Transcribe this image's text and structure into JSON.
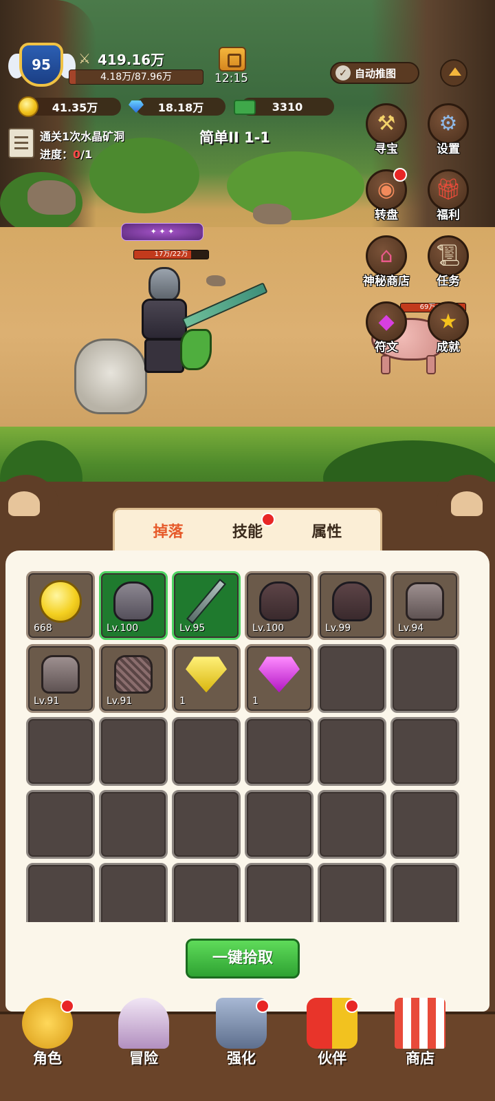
{
  "player": {
    "level": "95",
    "power": "419.16万",
    "exp_text": "4.18万/87.96万",
    "exp_fraction": 0.0475,
    "time": "12:15"
  },
  "auto_push": {
    "label": "自动推图",
    "checked": true
  },
  "resources": {
    "gold": "41.35万",
    "diamond": "18.18万",
    "cash": "3310"
  },
  "quest": {
    "title": "通关1次水晶矿洞",
    "progress_label": "进度：",
    "progress_current": "0",
    "progress_total": "/1"
  },
  "stage": "简单II 1-1",
  "side_menu": [
    {
      "label": "寻宝",
      "icon": "hammer-icon",
      "badge": false
    },
    {
      "label": "设置",
      "icon": "gear-icon",
      "badge": false
    },
    {
      "label": "转盘",
      "icon": "wheel-icon",
      "badge": true
    },
    {
      "label": "福利",
      "icon": "gift-icon",
      "badge": false
    },
    {
      "label": "神秘商店",
      "icon": "shop-icon",
      "badge": false
    },
    {
      "label": "任务",
      "icon": "scroll-icon",
      "badge": false
    },
    {
      "label": "符文",
      "icon": "rune-gem-icon",
      "badge": false
    },
    {
      "label": "成就",
      "icon": "star-icon",
      "badge": false
    }
  ],
  "battle": {
    "hero_hp_text": "17万/22万",
    "hero_hp_fraction": 0.77,
    "enemy_hp_text": "69万/69",
    "enemy_hp_fraction": 1.0
  },
  "tabs": [
    {
      "label": "掉落",
      "active": true,
      "badge": false
    },
    {
      "label": "技能",
      "active": false,
      "badge": true
    },
    {
      "label": "属性",
      "active": false,
      "badge": false
    }
  ],
  "loot": [
    {
      "item": "gold-coin",
      "text": "668",
      "style": "filled"
    },
    {
      "item": "helmet",
      "text": "Lv.100",
      "style": "green"
    },
    {
      "item": "sword",
      "text": "Lv.95",
      "style": "green"
    },
    {
      "item": "helmet-dark",
      "text": "Lv.100",
      "style": "filled"
    },
    {
      "item": "boots",
      "text": "Lv.99",
      "style": "filled"
    },
    {
      "item": "chest-armor",
      "text": "Lv.94",
      "style": "filled"
    },
    {
      "item": "chest-armor",
      "text": "Lv.91",
      "style": "filled"
    },
    {
      "item": "chest-mesh",
      "text": "Lv.91",
      "style": "filled"
    },
    {
      "item": "yellow-gem",
      "text": "1",
      "style": "filled"
    },
    {
      "item": "purple-gem",
      "text": "1",
      "style": "filled"
    }
  ],
  "pickup_button": "一键拾取",
  "bottom_nav": [
    {
      "label": "角色",
      "icon": "character-icon",
      "badge": true
    },
    {
      "label": "冒险",
      "icon": "portal-icon",
      "badge": false
    },
    {
      "label": "强化",
      "icon": "anvil-icon",
      "badge": true
    },
    {
      "label": "伙伴",
      "icon": "partner-icon",
      "badge": true
    },
    {
      "label": "商店",
      "icon": "store-icon",
      "badge": false
    }
  ]
}
